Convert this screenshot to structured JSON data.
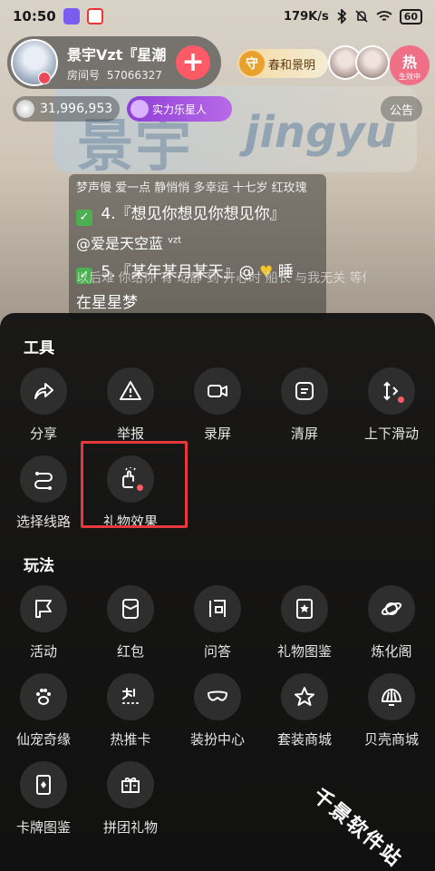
{
  "status_bar": {
    "time": "10:50",
    "network_speed": "179K/s",
    "battery": "60"
  },
  "host": {
    "name": "景宇Vzt『星潮",
    "room_label": "房间号",
    "room_id": "57066327",
    "follow_symbol": "+"
  },
  "guard": {
    "icon": "守",
    "label": "春和景明"
  },
  "hot_badge": {
    "label": "热",
    "sub": "生效中"
  },
  "stats": {
    "coins": "31,996,953",
    "tag": "实力乐星人",
    "notice_label": "公告"
  },
  "background_art": {
    "title": "景宇",
    "subtitle": "jingyu"
  },
  "song_panel": {
    "meta": "梦声慢  爱一点  静悄悄  多幸运  十七岁  红玫瑰",
    "line1_prefix": "4.",
    "line1": "『想见你想见你想见你』",
    "line1_by": "@爱是天空蓝",
    "line1_tag": "vzt",
    "line2_prefix": "5.",
    "line2": "『某年某月某天』@",
    "line2_by": "睡",
    "line3": "在星星梦"
  },
  "background_chat": "以后难 你给你 有 动静 到 开心时 船长 与我无关 等你下课 明天你好",
  "tools_section": {
    "title": "工具",
    "items": [
      {
        "label": "分享",
        "icon": "share-icon"
      },
      {
        "label": "举报",
        "icon": "report-icon"
      },
      {
        "label": "录屏",
        "icon": "record-screen-icon"
      },
      {
        "label": "清屏",
        "icon": "clear-screen-icon"
      },
      {
        "label": "上下滑动",
        "icon": "swipe-updown-icon"
      },
      {
        "label": "选择线路",
        "icon": "route-icon"
      },
      {
        "label": "礼物效果",
        "icon": "gift-effect-icon"
      }
    ]
  },
  "play_section": {
    "title": "玩法",
    "items": [
      {
        "label": "活动",
        "icon": "activity-icon"
      },
      {
        "label": "红包",
        "icon": "red-packet-icon"
      },
      {
        "label": "问答",
        "icon": "qa-icon"
      },
      {
        "label": "礼物图鉴",
        "icon": "gift-book-icon"
      },
      {
        "label": "炼化阁",
        "icon": "planet-icon"
      },
      {
        "label": "仙宠奇缘",
        "icon": "paw-icon"
      },
      {
        "label": "热推卡",
        "icon": "hot-card-icon"
      },
      {
        "label": "装扮中心",
        "icon": "mask-icon"
      },
      {
        "label": "套装商城",
        "icon": "star-icon"
      },
      {
        "label": "贝壳商城",
        "icon": "shell-icon"
      },
      {
        "label": "卡牌图鉴",
        "icon": "card-icon"
      },
      {
        "label": "拼团礼物",
        "icon": "group-gift-icon"
      }
    ]
  },
  "watermark": "千景软件站",
  "colors": {
    "sheet_bg": "#0e0e0e",
    "icon_circle": "#2e2e2e",
    "highlight_border": "#e8383d",
    "follow_button": "#ff5a66"
  }
}
